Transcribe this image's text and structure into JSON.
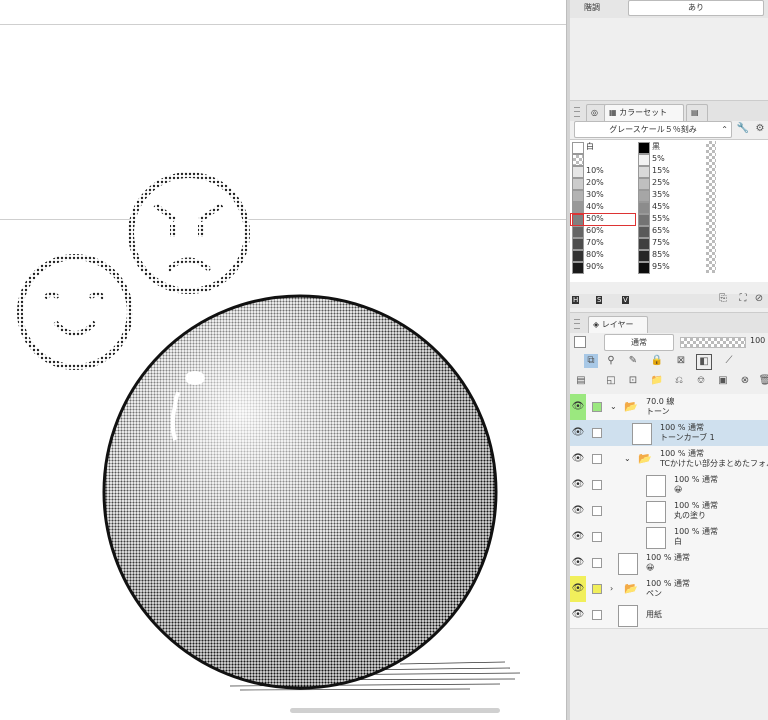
{
  "top_field": {
    "label": "階調",
    "value": "あり"
  },
  "color_set": {
    "tab_label": "カラーセット",
    "preset": "グレースケール５％刻み",
    "swatches_left": [
      "白",
      "",
      "10%",
      "20%",
      "30%",
      "40%",
      "50%",
      "60%",
      "70%",
      "80%",
      "90%"
    ],
    "swatches_right": [
      "黒",
      "5%",
      "15%",
      "25%",
      "35%",
      "45%",
      "55%",
      "65%",
      "75%",
      "85%",
      "95%"
    ],
    "selected_index": 6,
    "bottom_letters": [
      "H",
      "S",
      "V"
    ]
  },
  "layer_panel": {
    "tab_label": "レイヤー",
    "blend_mode": "通常",
    "opacity": "100",
    "layers": [
      {
        "opacity": "70.0 線",
        "name": "トーン",
        "indent": 0,
        "type": "folder",
        "eye_color": "green",
        "expanded": true
      },
      {
        "opacity": "100 % 通常",
        "name": "トーンカーブ 1",
        "indent": 1,
        "type": "correction",
        "eye_color": "none",
        "selected": true
      },
      {
        "opacity": "100 % 通常",
        "name": "TCかけたい部分まとめたフォル",
        "indent": 1,
        "type": "folder",
        "eye_color": "none",
        "expanded": true
      },
      {
        "opacity": "100 % 通常",
        "name": "😀",
        "indent": 2,
        "type": "raster",
        "eye_color": "none"
      },
      {
        "opacity": "100 % 通常",
        "name": "丸の塗り",
        "indent": 2,
        "type": "raster",
        "eye_color": "none"
      },
      {
        "opacity": "100 % 通常",
        "name": "白",
        "indent": 2,
        "type": "raster",
        "eye_color": "none"
      },
      {
        "opacity": "100 % 通常",
        "name": "😀",
        "indent": 0,
        "type": "raster",
        "eye_color": "none"
      },
      {
        "opacity": "100 % 通常",
        "name": "ペン",
        "indent": 0,
        "type": "folder",
        "eye_color": "yellow",
        "expanded": false
      },
      {
        "opacity": "",
        "name": "用紙",
        "indent": 0,
        "type": "paper",
        "eye_color": "none"
      }
    ]
  }
}
